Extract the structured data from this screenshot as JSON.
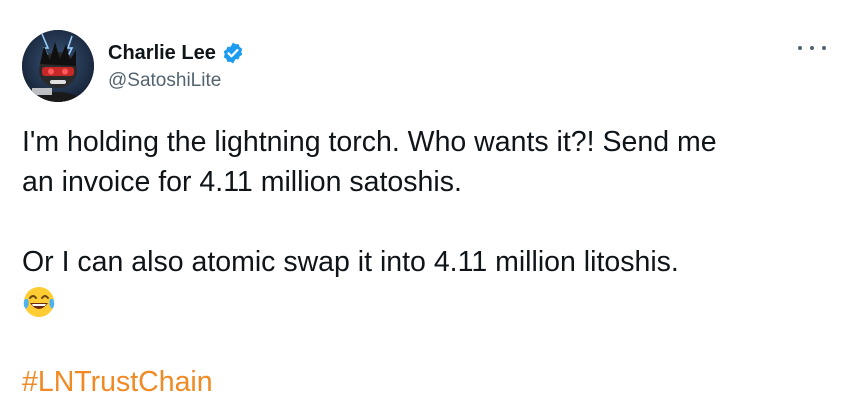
{
  "author": {
    "display_name": "Charlie Lee",
    "handle": "@SatoshiLite",
    "verified": true,
    "verified_color": "#1d9bf0"
  },
  "tweet": {
    "line1": "I'm holding the lightning torch. Who wants it?! Send me",
    "line2": "an invoice for 4.11 million satoshis.",
    "line3": "Or I can also atomic swap it into 4.11 million litoshis.",
    "emoji": "face-with-tears-of-joy",
    "hashtag": "#LNTrustChain",
    "hashtag_color": "#f08a24"
  },
  "icons": {
    "more": "more-options-icon",
    "verified": "verified-badge-icon"
  }
}
